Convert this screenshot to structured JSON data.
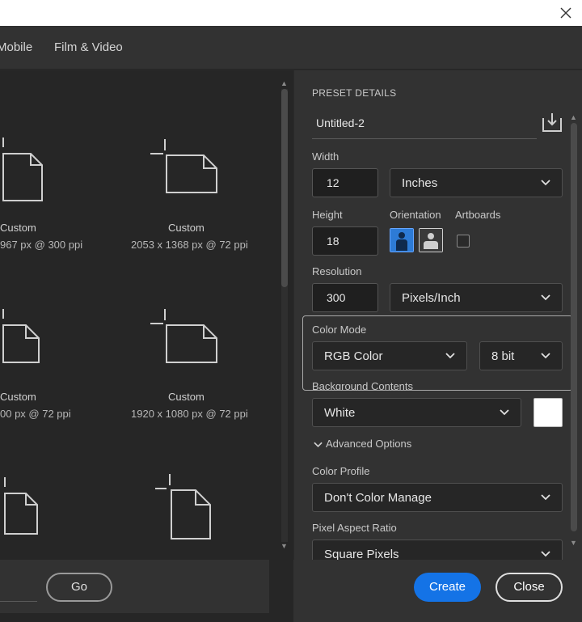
{
  "tabs": [
    {
      "label": "Mobile"
    },
    {
      "label": "Film & Video"
    }
  ],
  "presets": [
    {
      "name": "Custom",
      "detail": "967 px @ 300 ppi"
    },
    {
      "name": "Custom",
      "detail": "2053 x 1368 px @ 72 ppi"
    },
    {
      "name": "Custom",
      "detail": "00 px @ 72 ppi"
    },
    {
      "name": "Custom",
      "detail": "1920 x 1080 px @ 72 ppi"
    }
  ],
  "search": {
    "go_label": "Go"
  },
  "preset_details": {
    "heading": "PRESET DETAILS",
    "name_value": "Untitled-2",
    "width_label": "Width",
    "width_value": "12",
    "width_unit": "Inches",
    "height_label": "Height",
    "height_value": "18",
    "orientation_label": "Orientation",
    "artboards_label": "Artboards",
    "resolution_label": "Resolution",
    "resolution_value": "300",
    "resolution_unit": "Pixels/Inch",
    "color_mode_label": "Color Mode",
    "color_mode_value": "RGB Color",
    "bit_depth_value": "8 bit",
    "background_label": "Background Contents",
    "background_value": "White",
    "advanced_label": "Advanced Options",
    "color_profile_label": "Color Profile",
    "color_profile_value": "Don't Color Manage",
    "pixel_aspect_label": "Pixel Aspect Ratio",
    "pixel_aspect_value": "Square Pixels"
  },
  "footer": {
    "create_label": "Create",
    "close_label": "Close"
  },
  "colors": {
    "accent": "#1473e6",
    "panel": "#323232",
    "grid_bg": "#262626",
    "swatch": "#ffffff"
  }
}
